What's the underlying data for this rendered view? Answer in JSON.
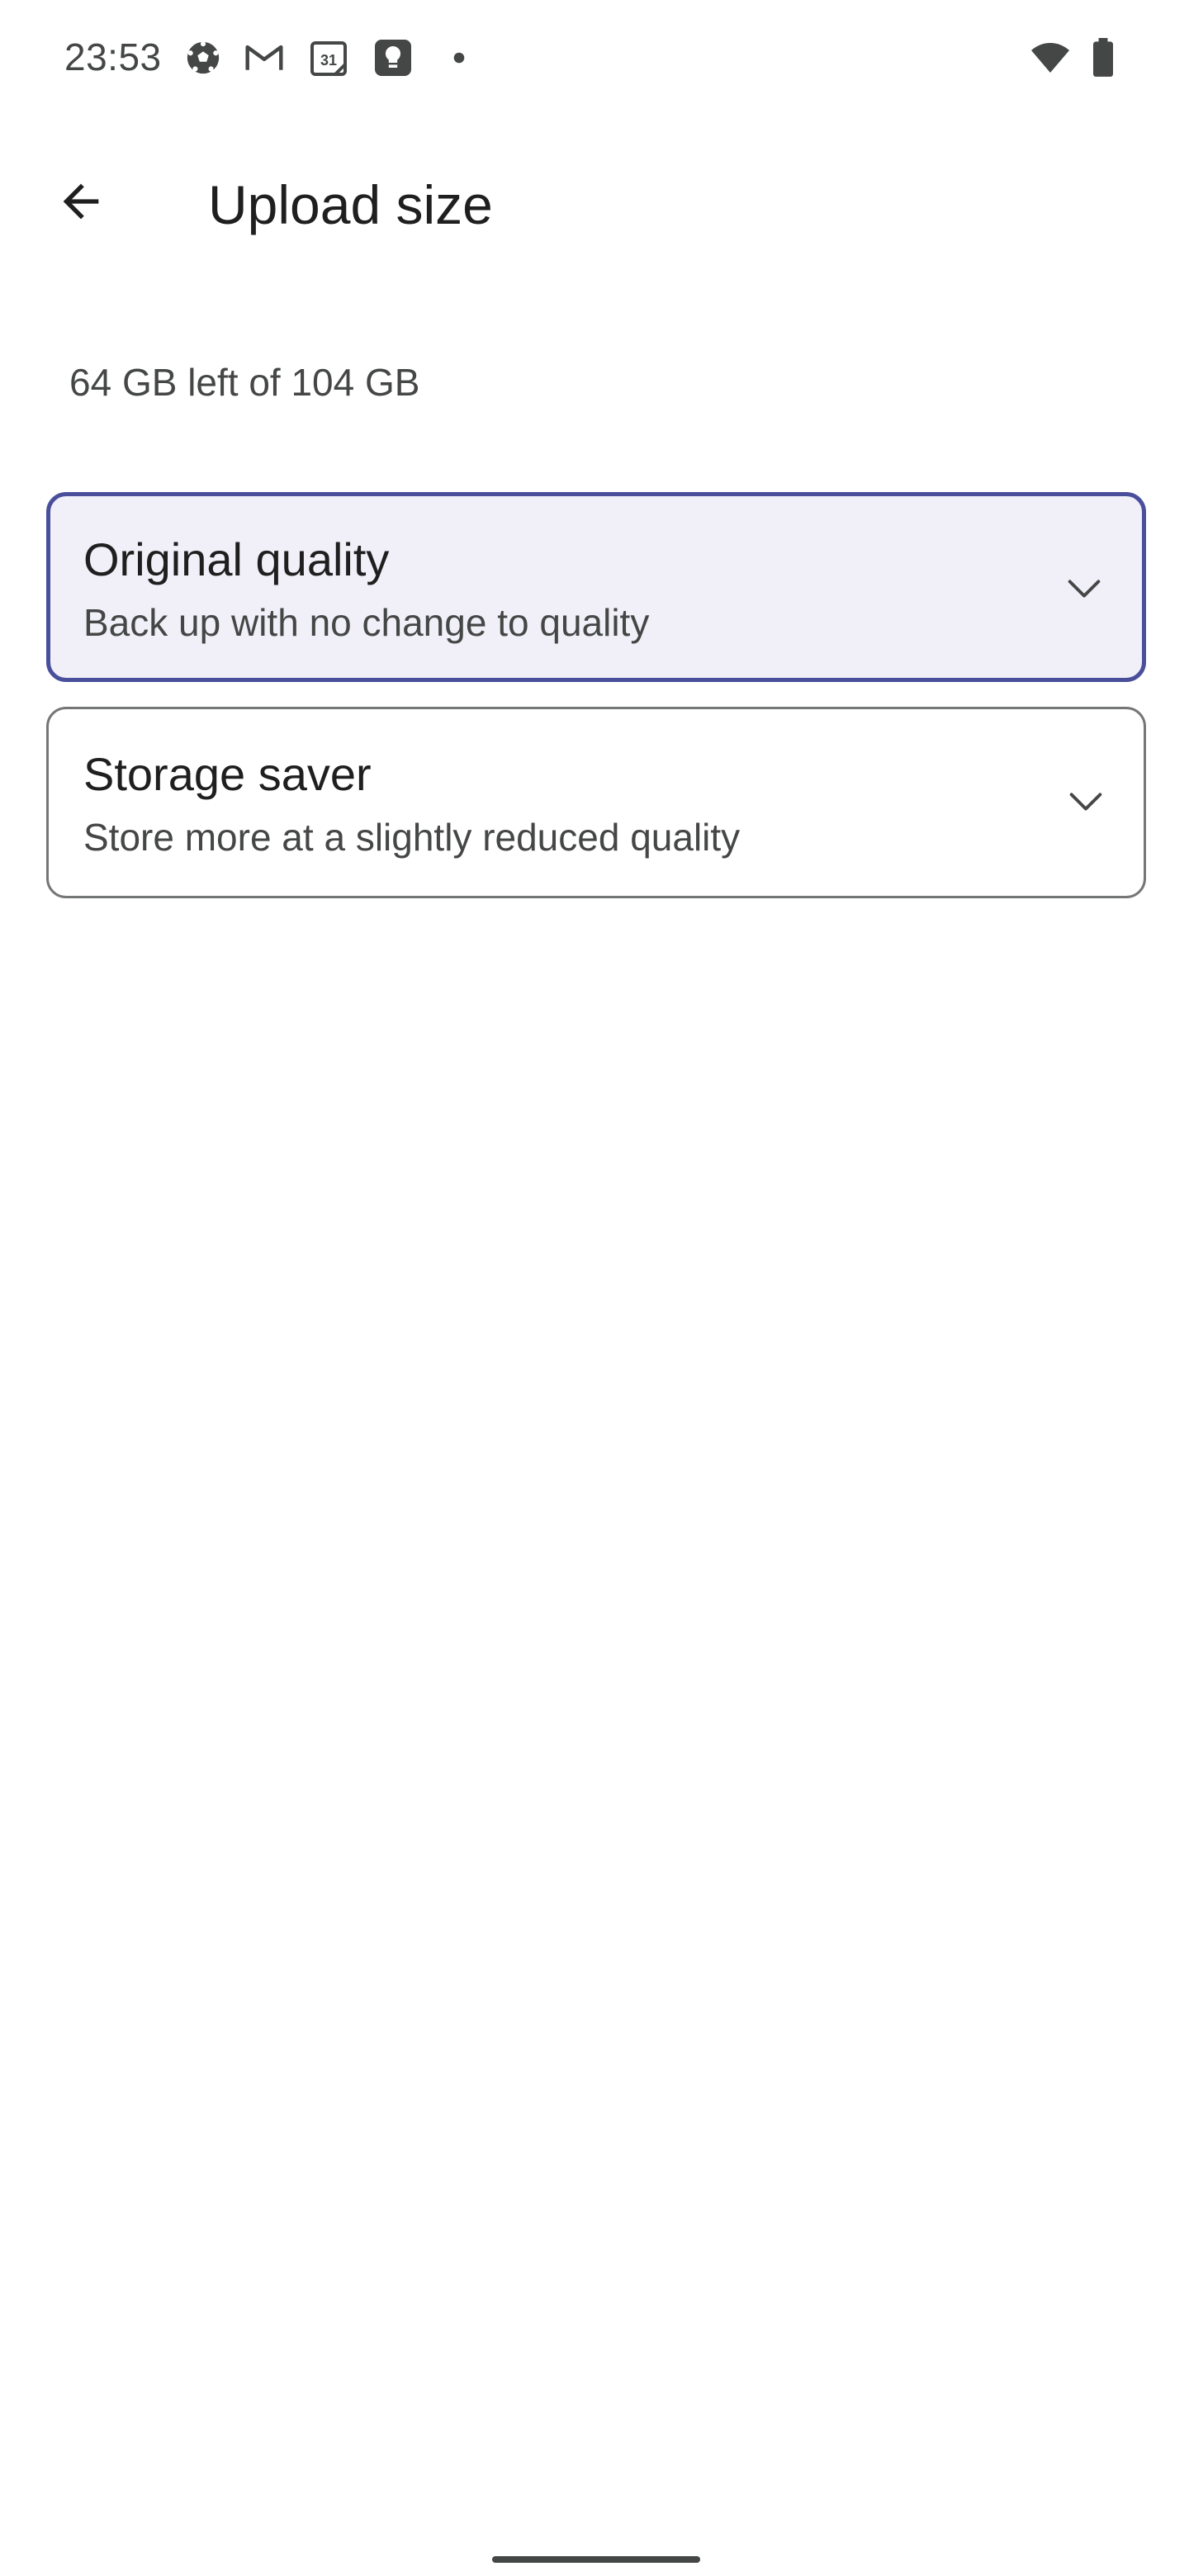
{
  "status_bar": {
    "time": "23:53",
    "calendar_date": "31",
    "icons": [
      "soccer-ball-icon",
      "gmail-icon",
      "calendar-icon",
      "keep-icon",
      "notification-dot-icon",
      "wifi-icon",
      "battery-icon"
    ]
  },
  "app_bar": {
    "back_icon": "arrow-back-icon",
    "title": "Upload size"
  },
  "storage": {
    "summary": "64 GB left of 104 GB"
  },
  "options": [
    {
      "title": "Original quality",
      "subtitle": "Back up with no change to quality",
      "selected": true,
      "icon": "chevron-down-icon"
    },
    {
      "title": "Storage saver",
      "subtitle": "Store more at a slightly reduced quality",
      "selected": false,
      "icon": "chevron-down-icon"
    }
  ],
  "colors": {
    "selected_border": "#4a4f9c",
    "selected_background": "#f1f0f8",
    "unselected_border": "#747775",
    "text_primary": "#1f1f1f",
    "text_secondary": "#444746"
  }
}
